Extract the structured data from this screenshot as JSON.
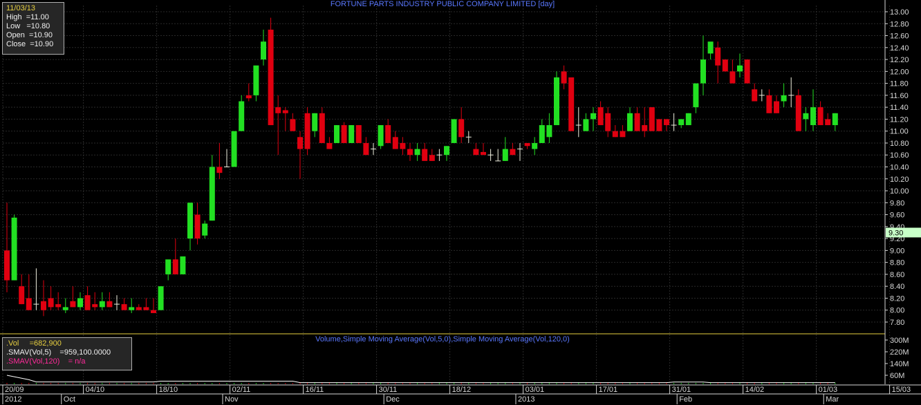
{
  "chart_data": {
    "type": "candlestick",
    "title": "FORTUNE PARTS INDUSTRY PUBLIC COMPANY LIMITED [day]",
    "price_axis": {
      "ylim": [
        7.7,
        13.1
      ],
      "ticks": [
        "7.80",
        "8.00",
        "8.20",
        "8.40",
        "8.60",
        "8.80",
        "9.00",
        "9.20",
        "9.40",
        "9.60",
        "9.80",
        "10.00",
        "10.20",
        "10.40",
        "10.60",
        "10.80",
        "11.00",
        "11.20",
        "11.40",
        "11.60",
        "11.80",
        "12.00",
        "12.20",
        "12.40",
        "12.60",
        "12.80",
        "13.00"
      ],
      "last_price_label": "9.30"
    },
    "volume_axis": {
      "ticks": [
        "300M",
        "220M",
        "140M",
        "60M"
      ],
      "tick_values": [
        300,
        220,
        140,
        60
      ],
      "ylim": [
        0,
        340
      ]
    },
    "volume_title": "Volume,Simple Moving Average(Vol,5,0),Simple Moving Average(Vol,120,0)",
    "x_labels_top": [
      "20/09",
      "04/10",
      "18/10",
      "02/11",
      "16/11",
      "30/11",
      "18/12",
      "03/01",
      "17/01",
      "31/01",
      "14/02",
      "01/03",
      "15/03"
    ],
    "x_labels_top_index": [
      0,
      11,
      21,
      31,
      41,
      51,
      61,
      71,
      81,
      91,
      101,
      111,
      121
    ],
    "x_labels_bottom": [
      "2012",
      "Oct",
      "Nov",
      "Dec",
      "2013",
      "Feb",
      "Mar"
    ],
    "x_labels_bottom_index": [
      0,
      8,
      30,
      52,
      70,
      92,
      112
    ],
    "ohlc": [
      [
        9.0,
        9.8,
        8.3,
        8.5
      ],
      [
        8.5,
        9.6,
        8.5,
        9.55
      ],
      [
        8.4,
        8.6,
        8.1,
        8.1
      ],
      [
        8.2,
        8.6,
        8.0,
        8.0
      ],
      [
        8.1,
        8.7,
        8.0,
        8.1
      ],
      [
        8.15,
        8.5,
        7.9,
        8.0
      ],
      [
        8.2,
        8.4,
        8.0,
        8.05
      ],
      [
        8.1,
        8.3,
        8.0,
        8.05
      ],
      [
        8.0,
        8.2,
        7.95,
        8.05
      ],
      [
        8.15,
        8.4,
        8.05,
        8.05
      ],
      [
        8.05,
        8.3,
        8.0,
        8.2
      ],
      [
        8.25,
        8.4,
        8.0,
        8.0
      ],
      [
        8.1,
        8.3,
        8.0,
        8.05
      ],
      [
        8.05,
        8.3,
        8.0,
        8.15
      ],
      [
        8.15,
        8.3,
        8.05,
        8.05
      ],
      [
        8.1,
        8.25,
        8.0,
        8.1
      ],
      [
        8.1,
        8.2,
        8.05,
        8.0
      ],
      [
        8.0,
        8.2,
        7.95,
        8.05
      ],
      [
        8.05,
        8.1,
        8.0,
        8.0
      ],
      [
        8.05,
        8.2,
        8.0,
        8.0
      ],
      [
        8.0,
        8.2,
        7.95,
        7.95
      ],
      [
        8.0,
        8.4,
        8.0,
        8.4
      ],
      [
        8.6,
        8.8,
        8.5,
        8.85
      ],
      [
        8.85,
        9.2,
        8.6,
        8.6
      ],
      [
        8.6,
        8.9,
        8.6,
        8.9
      ],
      [
        9.2,
        9.8,
        9.0,
        9.8
      ],
      [
        9.6,
        9.8,
        9.1,
        9.2
      ],
      [
        9.25,
        9.5,
        9.2,
        9.45
      ],
      [
        9.5,
        10.6,
        9.5,
        10.4
      ],
      [
        10.4,
        10.8,
        10.2,
        10.3
      ],
      [
        10.4,
        10.7,
        10.4,
        10.4
      ],
      [
        10.4,
        10.9,
        10.4,
        11.0
      ],
      [
        11.0,
        11.6,
        11.0,
        11.5
      ],
      [
        11.6,
        11.8,
        11.5,
        11.55
      ],
      [
        11.6,
        11.8,
        11.5,
        12.1
      ],
      [
        12.2,
        12.7,
        12.1,
        12.5
      ],
      [
        12.7,
        12.9,
        11.1,
        11.1
      ],
      [
        11.4,
        11.6,
        10.6,
        11.3
      ],
      [
        11.35,
        11.4,
        11.0,
        11.3
      ],
      [
        11.2,
        11.3,
        11.0,
        11.0
      ],
      [
        10.9,
        11.0,
        10.2,
        10.7
      ],
      [
        11.3,
        11.4,
        10.6,
        10.7
      ],
      [
        11.0,
        11.3,
        10.9,
        11.3
      ],
      [
        11.3,
        11.4,
        10.8,
        10.8
      ],
      [
        10.8,
        10.9,
        10.7,
        10.7
      ],
      [
        10.8,
        11.1,
        10.8,
        11.1
      ],
      [
        11.1,
        11.15,
        10.9,
        10.8
      ],
      [
        10.8,
        11.1,
        10.8,
        11.1
      ],
      [
        11.1,
        11.1,
        10.8,
        10.8
      ],
      [
        10.8,
        10.9,
        10.6,
        10.6
      ],
      [
        10.7,
        10.8,
        10.6,
        10.7
      ],
      [
        10.75,
        11.1,
        10.7,
        11.1
      ],
      [
        11.1,
        11.2,
        10.8,
        10.8
      ],
      [
        10.9,
        11.0,
        10.7,
        10.7
      ],
      [
        10.8,
        10.9,
        10.6,
        10.7
      ],
      [
        10.7,
        10.8,
        10.5,
        10.6
      ],
      [
        10.6,
        10.8,
        10.5,
        10.7
      ],
      [
        10.7,
        10.8,
        10.6,
        10.5
      ],
      [
        10.6,
        10.7,
        10.5,
        10.5
      ],
      [
        10.6,
        10.7,
        10.5,
        10.6
      ],
      [
        10.6,
        10.75,
        10.5,
        10.75
      ],
      [
        10.8,
        11.2,
        10.8,
        11.2
      ],
      [
        11.2,
        11.4,
        10.8,
        10.9
      ],
      [
        10.9,
        11.0,
        10.8,
        10.9
      ],
      [
        10.7,
        10.8,
        10.6,
        10.6
      ],
      [
        10.65,
        10.8,
        10.6,
        10.6
      ],
      [
        10.6,
        10.7,
        10.5,
        10.6
      ],
      [
        10.5,
        10.7,
        10.5,
        10.5
      ],
      [
        10.5,
        10.9,
        10.5,
        10.7
      ],
      [
        10.7,
        10.8,
        10.6,
        10.6
      ],
      [
        10.7,
        10.8,
        10.5,
        10.7
      ],
      [
        10.8,
        10.8,
        10.7,
        10.75
      ],
      [
        10.7,
        10.9,
        10.6,
        10.8
      ],
      [
        10.8,
        11.2,
        10.8,
        11.1
      ],
      [
        10.9,
        11.3,
        10.8,
        11.1
      ],
      [
        11.1,
        12.0,
        11.1,
        11.9
      ],
      [
        12.0,
        12.1,
        11.7,
        11.8
      ],
      [
        11.9,
        11.9,
        11.2,
        11.0
      ],
      [
        11.1,
        11.4,
        10.9,
        11.1
      ],
      [
        11.0,
        11.3,
        11.0,
        11.2
      ],
      [
        11.2,
        11.4,
        11.0,
        11.3
      ],
      [
        11.4,
        11.5,
        11.1,
        11.1
      ],
      [
        11.3,
        11.4,
        10.9,
        11.0
      ],
      [
        11.0,
        11.1,
        10.9,
        10.9
      ],
      [
        11.0,
        11.1,
        10.9,
        10.9
      ],
      [
        11.0,
        11.4,
        11.0,
        11.3
      ],
      [
        11.3,
        11.4,
        11.0,
        11.0
      ],
      [
        11.1,
        11.4,
        10.9,
        11.0
      ],
      [
        11.4,
        11.4,
        11.0,
        11.0
      ],
      [
        11.2,
        11.2,
        11.0,
        11.0
      ],
      [
        11.2,
        11.2,
        11.0,
        11.1
      ],
      [
        11.1,
        11.3,
        11.0,
        11.1
      ],
      [
        11.1,
        11.1,
        11.05,
        11.2
      ],
      [
        11.1,
        11.3,
        11.1,
        11.3
      ],
      [
        11.4,
        11.6,
        11.3,
        11.8
      ],
      [
        11.8,
        12.6,
        11.6,
        12.2
      ],
      [
        12.3,
        12.4,
        12.2,
        12.5
      ],
      [
        12.4,
        12.5,
        11.8,
        12.1
      ],
      [
        12.2,
        12.2,
        12.0,
        12.0
      ],
      [
        12.0,
        12.2,
        11.8,
        11.8
      ],
      [
        12.0,
        12.3,
        11.9,
        12.1
      ],
      [
        12.2,
        12.2,
        11.8,
        11.8
      ],
      [
        11.7,
        11.8,
        11.5,
        11.5
      ],
      [
        11.6,
        11.7,
        11.5,
        11.6
      ],
      [
        11.6,
        11.7,
        11.3,
        11.3
      ],
      [
        11.5,
        11.6,
        11.3,
        11.3
      ],
      [
        11.5,
        11.8,
        11.4,
        11.6
      ],
      [
        11.6,
        11.9,
        11.4,
        11.6
      ],
      [
        11.6,
        11.7,
        11.0,
        11.0
      ],
      [
        11.2,
        11.4,
        11.0,
        11.3
      ],
      [
        11.1,
        11.7,
        11.0,
        11.4
      ],
      [
        11.4,
        11.5,
        11.1,
        11.1
      ],
      [
        11.2,
        11.3,
        11.1,
        11.1
      ],
      [
        11.1,
        11.3,
        11.0,
        11.3
      ]
    ]
  },
  "legend_box": {
    "date": "11/03/13",
    "high": "High  =11.00",
    "low": "Low   =10.80",
    "open": "Open  =10.90",
    "close": "Close  =10.90"
  },
  "volume_box": {
    "vol": ".Vol     =682,900",
    "sma5": ".SMAV(Vol,5)    =959,100.0000",
    "sma120": ".SMAV(Vol,120)    = n/a"
  },
  "colors": {
    "up": "#22e022",
    "down": "#e00010",
    "axis": "#d8d8d8",
    "grid": "#2a2a2a",
    "separator": "#e8d040",
    "title": "#5a78ff",
    "last_price_bg": "#c8ffc8"
  }
}
